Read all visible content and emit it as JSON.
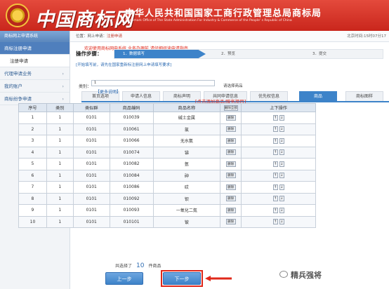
{
  "header": {
    "brand": "中国商标网",
    "agency": "中华人民共和国国家工商行政管理总局商标局",
    "agency_en": "Trademark Office of The State Administration For Industry & Commerce of the People' s Republic of China"
  },
  "sidebar": {
    "title": "商标网上申请系统",
    "items": [
      {
        "label": "商标注册申请"
      },
      {
        "label": "注册申请"
      },
      {
        "label": "代理申请业务"
      },
      {
        "label": "我的账户"
      },
      {
        "label": "商标纷争申请"
      }
    ]
  },
  "topbar": {
    "crumb_prefix": "位置：网上申请：",
    "crumb_current": "注册申请",
    "time": "北京时间:15时07分17"
  },
  "welcome": "欢迎使用商标网申系统,业务办理前,请仔细阅读申请指南",
  "steps": {
    "label": "操作步骤：",
    "items": [
      "1．数据填写",
      "2．预览",
      "3．提交"
    ]
  },
  "hint": "[开始填写前，请先在国家重新标注册网上申请填写要求]",
  "tabs": [
    "首页选项",
    "申请人信息",
    "商标声明",
    "共同申请信息",
    "优先权信息",
    "商品",
    "商标图样"
  ],
  "active_tab": "商品",
  "category": {
    "label": "类别：",
    "value": "1",
    "choose_label": "请选择商品",
    "more_link": "【更多说明】"
  },
  "add_link": "[点击添加商品/服务项目]",
  "table": {
    "headers": [
      "序号",
      "类别",
      "类似群",
      "商品编码",
      "商品名称",
      "删除全部",
      "上下操作"
    ],
    "rows": [
      {
        "no": "1",
        "cls": "1",
        "group": "0101",
        "code": "010039",
        "name": "碱土金属"
      },
      {
        "no": "2",
        "cls": "1",
        "group": "0101",
        "code": "010061",
        "name": "氯"
      },
      {
        "no": "3",
        "cls": "1",
        "group": "0101",
        "code": "010066",
        "name": "无水氨"
      },
      {
        "no": "4",
        "cls": "1",
        "group": "0101",
        "code": "010074",
        "name": "锑"
      },
      {
        "no": "5",
        "cls": "1",
        "group": "0101",
        "code": "010082",
        "name": "氩"
      },
      {
        "no": "6",
        "cls": "1",
        "group": "0101",
        "code": "010084",
        "name": "砷"
      },
      {
        "no": "7",
        "cls": "1",
        "group": "0101",
        "code": "010086",
        "name": "砹"
      },
      {
        "no": "8",
        "cls": "1",
        "group": "0101",
        "code": "010092",
        "name": "钡"
      },
      {
        "no": "9",
        "cls": "1",
        "group": "0101",
        "code": "010093",
        "name": "一氧化二氮"
      },
      {
        "no": "10",
        "cls": "1",
        "group": "0101",
        "code": "010101",
        "name": "铍"
      }
    ],
    "delete_label": "删除",
    "up_label": "↑",
    "down_label": "↓"
  },
  "summary": {
    "prefix": "共选择了",
    "count": "10",
    "suffix": "件商品"
  },
  "buttons": {
    "prev": "上一步",
    "next": "下一步"
  },
  "watermark": "精兵强将",
  "colors": {
    "header": "#d6362a",
    "accent": "#3d83c9",
    "highlight": "#e0281a"
  }
}
